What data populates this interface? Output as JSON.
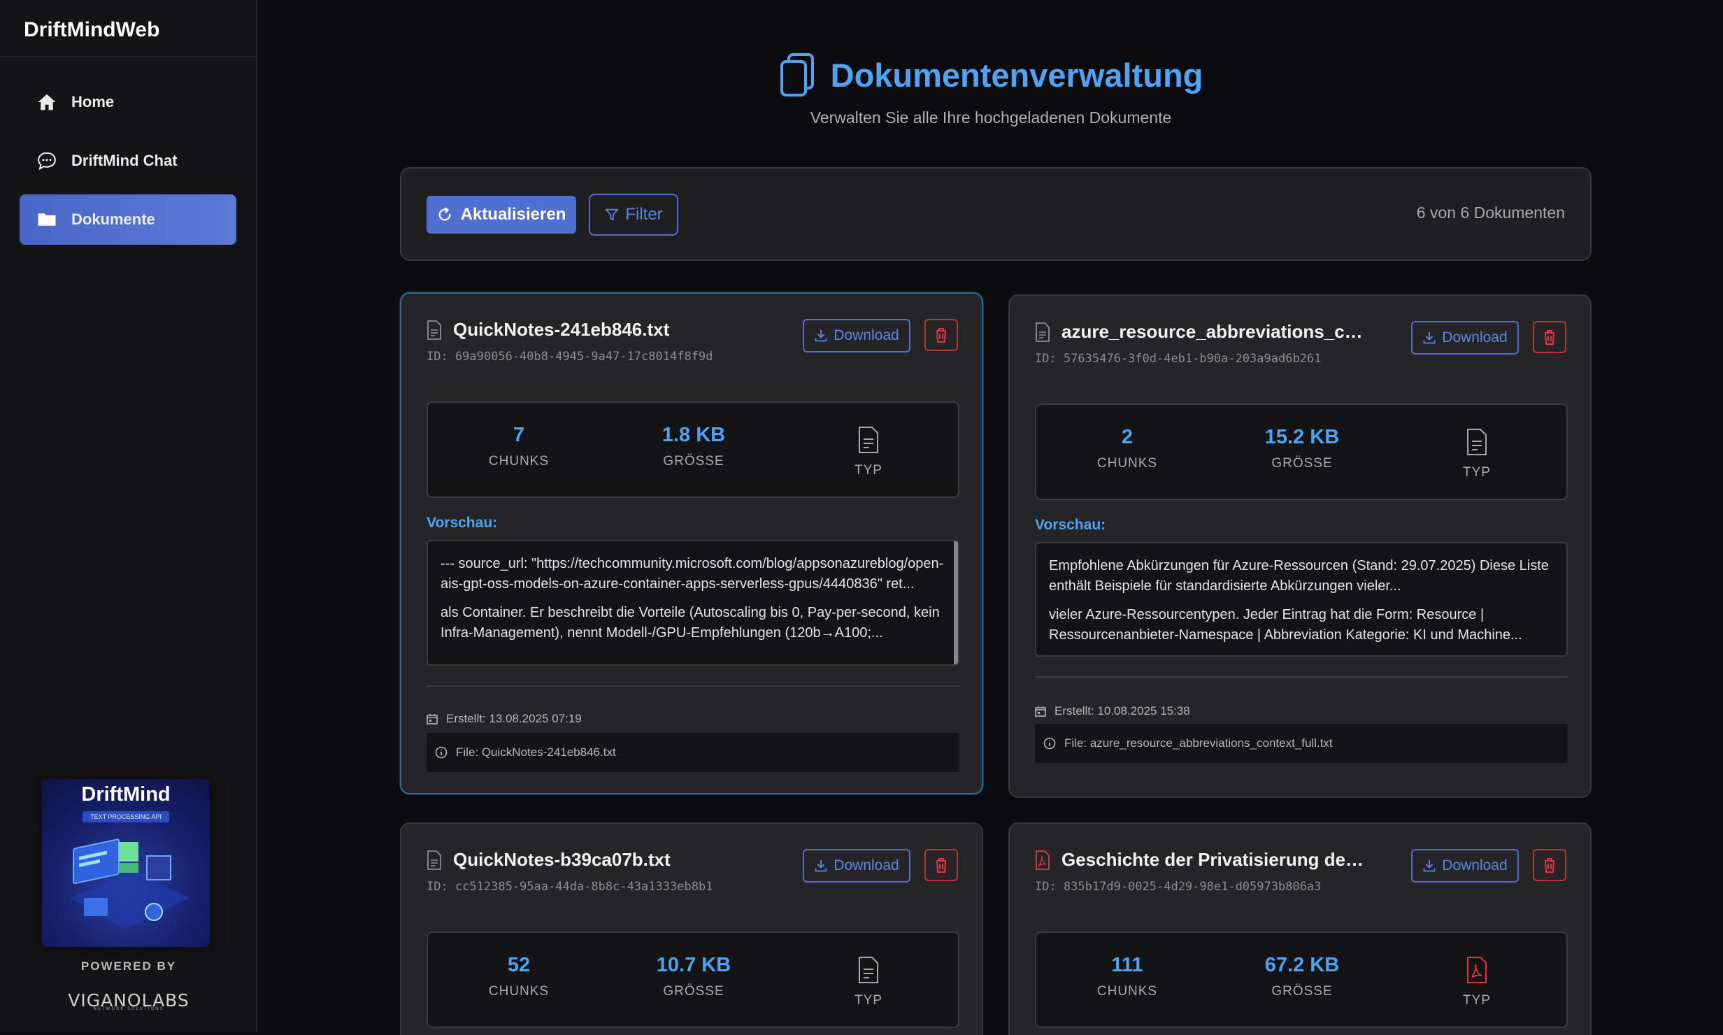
{
  "app": {
    "title": "DriftMindWeb"
  },
  "sidebar": {
    "items": [
      {
        "label": "Home",
        "icon": "home-icon",
        "active": false
      },
      {
        "label": "DriftMind Chat",
        "icon": "chat-icon",
        "active": false
      },
      {
        "label": "Dokumente",
        "icon": "folder-icon",
        "active": true
      }
    ],
    "promo": {
      "title": "DriftMind",
      "subtitle": "TEXT PROCESSING API"
    },
    "powered_by": "POWERED BY",
    "company": "VIGANOLABS",
    "company_tagline": "NETWORK SOLUTIONS"
  },
  "header": {
    "title": "Dokumentenverwaltung",
    "subtitle": "Verwalten Sie alle Ihre hochgeladenen Dokumente"
  },
  "toolbar": {
    "refresh_label": "Aktualisieren",
    "filter_label": "Filter",
    "count_text": "6 von 6 Dokumenten"
  },
  "labels": {
    "download": "Download",
    "chunks": "CHUNKS",
    "size": "GRÖSSE",
    "type": "TYP",
    "preview": "Vorschau:"
  },
  "colors": {
    "accent": "#4ea4f4",
    "primary_button": "#4f6fd1",
    "danger": "#b83438",
    "pdf": "#e0383e"
  },
  "documents": [
    {
      "name": "QuickNotes-241eb846.txt",
      "id": "ID: 69a90056-40b8-4945-9a47-17c8014f8f9d",
      "chunks": "7",
      "size": "1.8 KB",
      "type_icon": "text-file-icon",
      "preview": [
        "--- source_url: \"https://techcommunity.microsoft.com/blog/appsonazureblog/open-ais-gpt-oss-models-on-azure-container-apps-serverless-gpus/4440836\" ret...",
        "als Container. Er beschreibt die Vorteile (Autoscaling bis 0, Pay-per-second, kein Infra-Management), nennt Modell-/GPU-Empfehlungen (120b→A100;..."
      ],
      "created": "Erstellt: 13.08.2025 07:19",
      "file": "File: QuickNotes-241eb846.txt"
    },
    {
      "name": "azure_resource_abbreviations_context_fu...",
      "id": "ID: 57635476-3f0d-4eb1-b90a-203a9ad6b261",
      "chunks": "2",
      "size": "15.2 KB",
      "type_icon": "text-file-icon",
      "preview": [
        "Empfohlene Abkürzungen für Azure-Ressourcen (Stand: 29.07.2025) Diese Liste enthält Beispiele für standardisierte Abkürzungen vieler...",
        "vieler Azure-Ressourcentypen. Jeder Eintrag hat die Form: Resource | Ressourcenanbieter-Namespace | Abbreviation Kategorie: KI und Machine..."
      ],
      "created": "Erstellt: 10.08.2025 15:38",
      "file": "File: azure_resource_abbreviations_context_full.txt"
    },
    {
      "name": "QuickNotes-b39ca07b.txt",
      "id": "ID: cc512385-95aa-44da-8b8c-43a1333eb8b1",
      "chunks": "52",
      "size": "10.7 KB",
      "type_icon": "text-file-icon"
    },
    {
      "name": "Geschichte der Privatisierung der Teleko...",
      "id": "ID: 835b17d9-0025-4d29-98e1-d05973b806a3",
      "chunks": "111",
      "size": "67.2 KB",
      "type_icon": "pdf-file-icon"
    }
  ]
}
